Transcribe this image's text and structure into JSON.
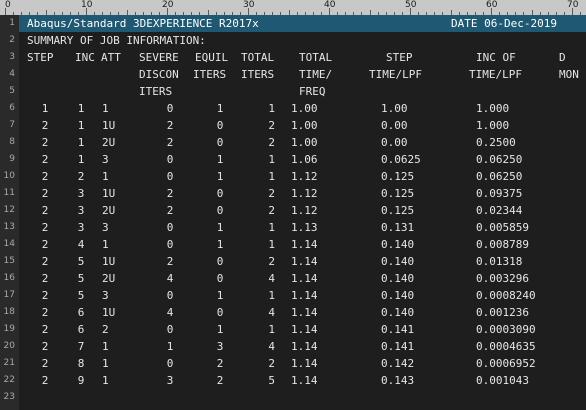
{
  "ruler": {
    "labels": [
      "0",
      "10",
      "20",
      "30",
      "40",
      "50",
      "60",
      "70"
    ]
  },
  "lines": [
    {
      "n": "1",
      "header": true,
      "title": "Abaqus/Standard 3DEXPERIENCE R2017x",
      "date": "DATE 06-Dec-2019"
    },
    {
      "n": "2",
      "text": "SUMMARY OF JOB INFORMATION:"
    },
    {
      "n": "3",
      "cells": [
        "STEP",
        "INC",
        "ATT",
        "SEVERE",
        "EQUIL",
        "TOTAL",
        "TOTAL",
        "STEP",
        "INC OF",
        "D"
      ]
    },
    {
      "n": "4",
      "cells": [
        "",
        "",
        "",
        "DISCON",
        "ITERS",
        "ITERS",
        "TIME/",
        "TIME/LPF",
        "TIME/LPF",
        "MON"
      ]
    },
    {
      "n": "5",
      "cells": [
        "",
        "",
        "",
        "ITERS",
        "",
        "",
        "FREQ",
        "",
        "",
        ""
      ]
    },
    {
      "n": "6",
      "cells": [
        "1",
        "1",
        "1",
        "0",
        "1",
        "1",
        "1.00",
        "1.00",
        "1.000"
      ]
    },
    {
      "n": "7",
      "cells": [
        "2",
        "1",
        "1U",
        "2",
        "0",
        "2",
        "1.00",
        "0.00",
        "1.000"
      ]
    },
    {
      "n": "8",
      "cells": [
        "2",
        "1",
        "2U",
        "2",
        "0",
        "2",
        "1.00",
        "0.00",
        "0.2500"
      ]
    },
    {
      "n": "9",
      "cells": [
        "2",
        "1",
        "3",
        "0",
        "1",
        "1",
        "1.06",
        "0.0625",
        "0.06250"
      ]
    },
    {
      "n": "10",
      "cells": [
        "2",
        "2",
        "1",
        "0",
        "1",
        "1",
        "1.12",
        "0.125",
        "0.06250"
      ]
    },
    {
      "n": "11",
      "cells": [
        "2",
        "3",
        "1U",
        "2",
        "0",
        "2",
        "1.12",
        "0.125",
        "0.09375"
      ]
    },
    {
      "n": "12",
      "cells": [
        "2",
        "3",
        "2U",
        "2",
        "0",
        "2",
        "1.12",
        "0.125",
        "0.02344"
      ]
    },
    {
      "n": "13",
      "cells": [
        "2",
        "3",
        "3",
        "0",
        "1",
        "1",
        "1.13",
        "0.131",
        "0.005859"
      ]
    },
    {
      "n": "14",
      "cells": [
        "2",
        "4",
        "1",
        "0",
        "1",
        "1",
        "1.14",
        "0.140",
        "0.008789"
      ]
    },
    {
      "n": "15",
      "cells": [
        "2",
        "5",
        "1U",
        "2",
        "0",
        "2",
        "1.14",
        "0.140",
        "0.01318"
      ]
    },
    {
      "n": "16",
      "cells": [
        "2",
        "5",
        "2U",
        "4",
        "0",
        "4",
        "1.14",
        "0.140",
        "0.003296"
      ]
    },
    {
      "n": "17",
      "cells": [
        "2",
        "5",
        "3",
        "0",
        "1",
        "1",
        "1.14",
        "0.140",
        "0.0008240"
      ]
    },
    {
      "n": "18",
      "cells": [
        "2",
        "6",
        "1U",
        "4",
        "0",
        "4",
        "1.14",
        "0.140",
        "0.001236"
      ]
    },
    {
      "n": "19",
      "cells": [
        "2",
        "6",
        "2",
        "0",
        "1",
        "1",
        "1.14",
        "0.141",
        "0.0003090"
      ]
    },
    {
      "n": "20",
      "cells": [
        "2",
        "7",
        "1",
        "1",
        "3",
        "4",
        "1.14",
        "0.141",
        "0.0004635"
      ]
    },
    {
      "n": "21",
      "cells": [
        "2",
        "8",
        "1",
        "0",
        "2",
        "2",
        "1.14",
        "0.142",
        "0.0006952"
      ]
    },
    {
      "n": "22",
      "cells": [
        "2",
        "9",
        "1",
        "3",
        "2",
        "5",
        "1.14",
        "0.143",
        "0.001043"
      ]
    },
    {
      "n": "23"
    }
  ]
}
